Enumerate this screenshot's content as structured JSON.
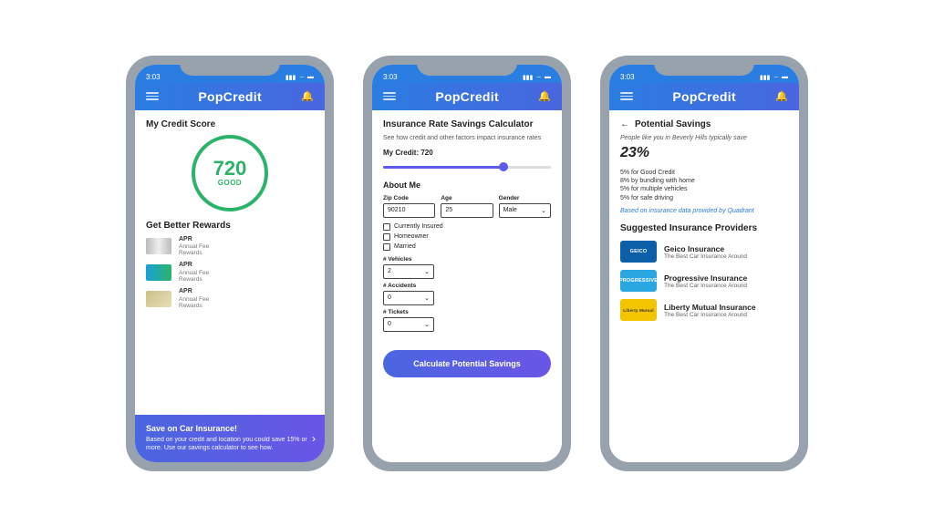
{
  "status": {
    "time": "3:03"
  },
  "app": {
    "title": "PopCredit"
  },
  "screen1": {
    "score_title": "My Credit Score",
    "score": "720",
    "score_rating": "GOOD",
    "rewards_title": "Get Better Rewards",
    "rewards": [
      {
        "apr": "APR",
        "sub1": "Annual Fee",
        "sub2": "Rewards"
      },
      {
        "apr": "APR",
        "sub1": "Annual Fee",
        "sub2": "Rewards"
      },
      {
        "apr": "APR",
        "sub1": "Annual Fee",
        "sub2": "Rewards"
      }
    ],
    "promo_title": "Save on Car Insurance!",
    "promo_body": "Based on your credit and location you could save 15% or more. Use our savings calculator to see how."
  },
  "screen2": {
    "title": "Insurance Rate Savings Calculator",
    "subtitle": "See how credit and other factors impact insurance rates",
    "mycredit": "My Credit: 720",
    "about": "About Me",
    "zip_label": "Zip Code",
    "zip": "90210",
    "age_label": "Age",
    "age": "25",
    "gender_label": "Gender",
    "gender": "Male",
    "chk1": "Currently Insured",
    "chk2": "Homeowner",
    "chk3": "Married",
    "veh_label": "# Vehicles",
    "veh": "2",
    "acc_label": "# Accidents",
    "acc": "0",
    "tic_label": "# Tickets",
    "tic": "0",
    "button": "Calculate Potential Savings"
  },
  "screen3": {
    "back": "Potential Savings",
    "intro": "People like you in Beverly Hills typically save",
    "pct": "23%",
    "line1": "5% for Good Credit",
    "line2": "8% by bundling with home",
    "line3": "5% for multiple vehicles",
    "line4": "5% for safe driving",
    "source": "Based on insurance data provided by Quadrant",
    "sugg": "Suggested Insurance Providers",
    "providers": [
      {
        "logo": "GEICO",
        "name": "Geico Insurance",
        "tag": "The Best Car Insurance Around"
      },
      {
        "logo": "PROGRESSIVE",
        "name": "Progressive Insurance",
        "tag": "The Best Car Insurance Around"
      },
      {
        "logo": "Liberty Mutual",
        "name": "Liberty Mutual Insurance",
        "tag": "The Best Car Insurance Around"
      }
    ]
  }
}
